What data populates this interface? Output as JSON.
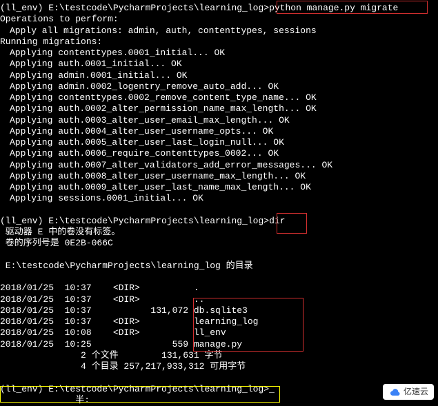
{
  "prompt1_prefix": "(ll_env) E:\\testcode\\PycharmProjects\\learning_log>",
  "cmd1": "python manage.py migrate",
  "ops_header": "Operations to perform:",
  "apply_all": "Apply all migrations: admin, auth, contenttypes, sessions",
  "running": "Running migrations:",
  "migrations": [
    "Applying contenttypes.0001_initial... OK",
    "Applying auth.0001_initial... OK",
    "Applying admin.0001_initial... OK",
    "Applying admin.0002_logentry_remove_auto_add... OK",
    "Applying contenttypes.0002_remove_content_type_name... OK",
    "Applying auth.0002_alter_permission_name_max_length... OK",
    "Applying auth.0003_alter_user_email_max_length... OK",
    "Applying auth.0004_alter_user_username_opts... OK",
    "Applying auth.0005_alter_user_last_login_null... OK",
    "Applying auth.0006_require_contenttypes_0002... OK",
    "Applying auth.0007_alter_validators_add_error_messages... OK",
    "Applying auth.0008_alter_user_username_max_length... OK",
    "Applying auth.0009_alter_user_last_name_max_length... OK",
    "Applying sessions.0001_initial... OK"
  ],
  "prompt2_prefix": "(ll_env) E:\\testcode\\PycharmProjects\\learning_log>",
  "cmd2": "dir",
  "drive_label": " 驱动器 E 中的卷没有标签。",
  "serial": " 卷的序列号是 0E2B-066C",
  "dir_of": " E:\\testcode\\PycharmProjects\\learning_log 的目录",
  "dir_rows": [
    "2018/01/25  10:37    <DIR>          .",
    "2018/01/25  10:37    <DIR>          ..",
    "2018/01/25  10:37           131,072 db.sqlite3",
    "2018/01/25  10:37    <DIR>          learning_log",
    "2018/01/25  10:08    <DIR>          ll_env",
    "2018/01/25  10:25               559 manage.py"
  ],
  "summary_files": "               2 个文件        131,631 字节",
  "summary_dirs": "               4 个目录 257,217,933,312 可用字节",
  "prompt3_prefix": "(ll_env) E:\\testcode\\PycharmProjects\\learning_log>",
  "prompt3_cursor": "_",
  "prompt3_tail": "              半:",
  "logo_text": "亿速云"
}
